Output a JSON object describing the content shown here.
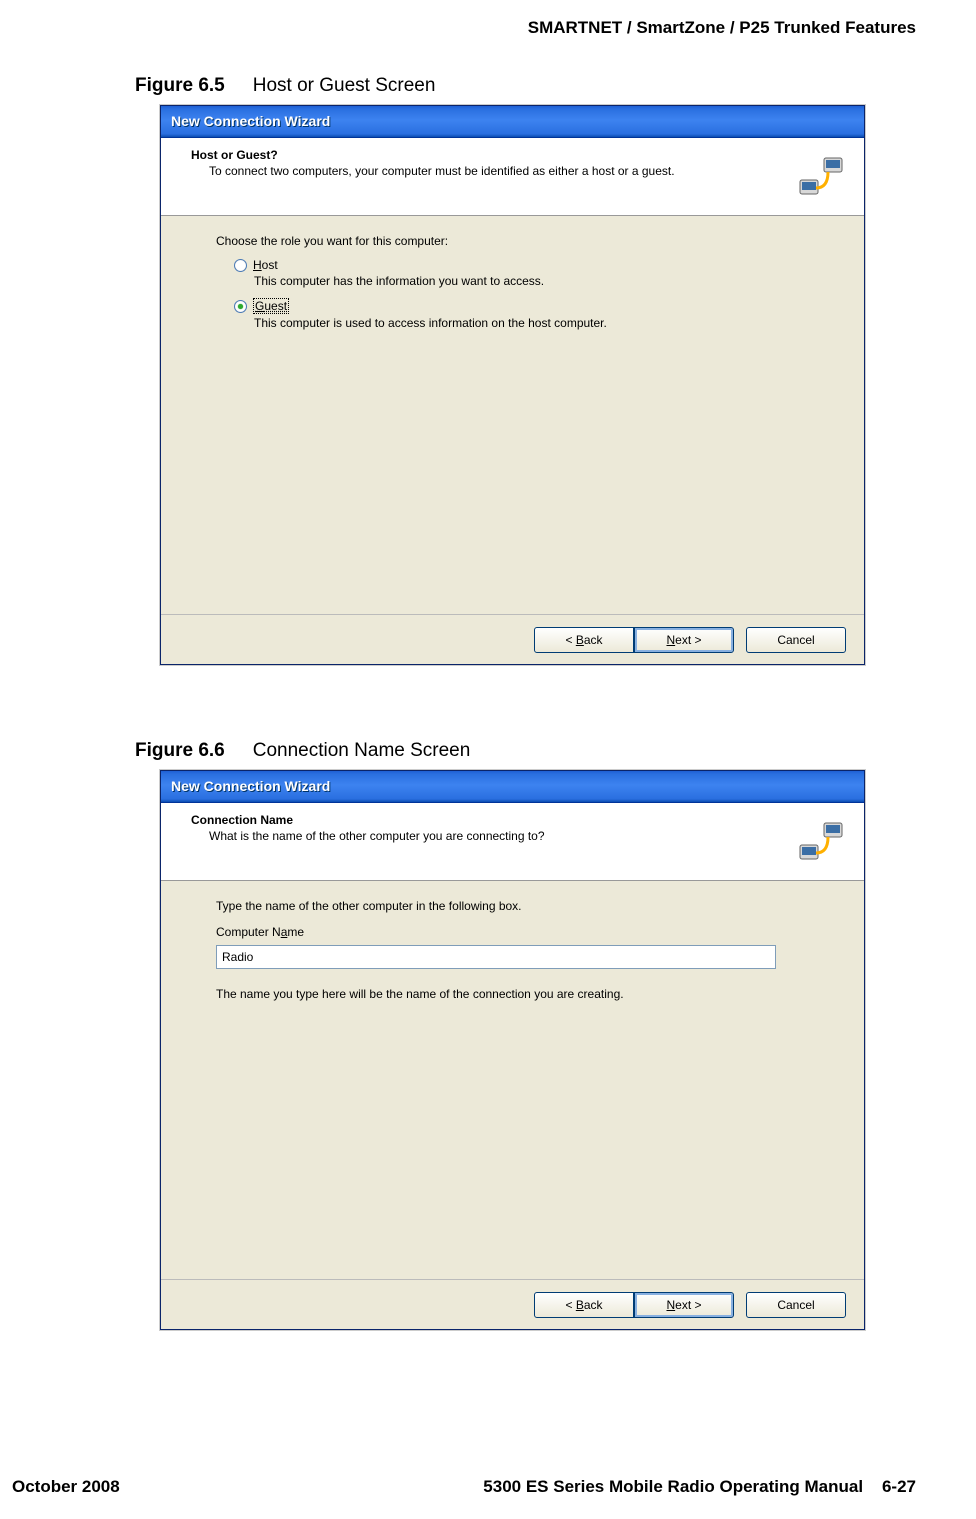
{
  "page": {
    "header_right": "SMARTNET / SmartZone / P25 Trunked Features",
    "footer_left": "October 2008",
    "footer_right_title": "5300 ES Series Mobile Radio Operating Manual",
    "footer_right_page": "6-27"
  },
  "figure1": {
    "num": "Figure 6.5",
    "title": "Host or Guest Screen",
    "window_title": "New Connection Wizard",
    "heading": "Host or Guest?",
    "subtext": "To connect two computers, your computer must be identified as either a host or a guest.",
    "prompt": "Choose the role you want for this computer:",
    "opt_host_label": "Host",
    "opt_host_desc": "This computer has the information you want to access.",
    "opt_guest_label": "Guest",
    "opt_guest_desc": "This computer is used to access information on the host computer.",
    "btn_back": "< Back",
    "btn_next": "Next >",
    "btn_cancel": "Cancel"
  },
  "figure2": {
    "num": "Figure 6.6",
    "title": "Connection Name Screen",
    "window_title": "New Connection Wizard",
    "heading": "Connection Name",
    "subtext": "What is the name of the other computer you are connecting to?",
    "prompt": "Type the name of the other computer in the following box.",
    "input_label": "Computer Name",
    "input_value": "Radio",
    "note": "The name you type here will be the name of the connection you are creating.",
    "btn_back": "< Back",
    "btn_next": "Next >",
    "btn_cancel": "Cancel"
  }
}
